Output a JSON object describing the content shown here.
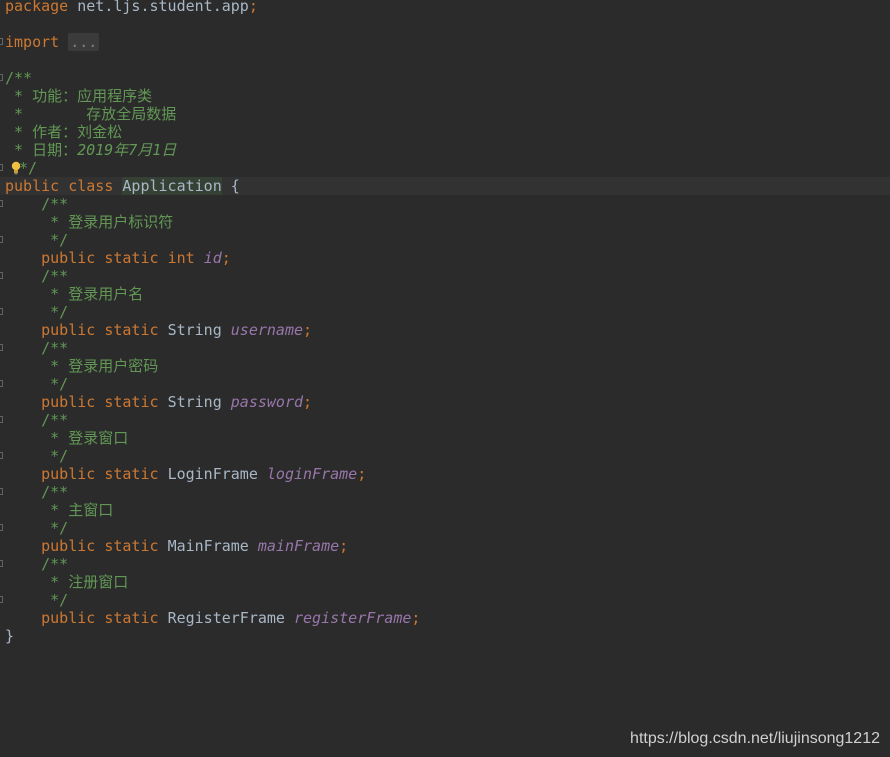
{
  "code": {
    "package_kw": "package",
    "package_name": "net.ljs.student.app",
    "semicolon": ";",
    "import_kw": "import",
    "import_folded": "...",
    "doc_open": "/**",
    "doc_close": "*/",
    "class_doc": {
      "line1": " * 功能：应用程序类",
      "line2": " *       存放全局数据",
      "line3": " * 作者：刘金松",
      "line4_prefix": " * 日期：",
      "line4_date": "2019年7月1日"
    },
    "class_decl": {
      "public_kw": "public",
      "class_kw": "class",
      "name": "Application",
      "open_brace": " {"
    },
    "fields": [
      {
        "doc": " * 登录用户标识符",
        "static_kw": "static",
        "type": "int",
        "type_is_keyword": true,
        "name": "id"
      },
      {
        "doc": " * 登录用户名",
        "static_kw": "static",
        "type": "String",
        "name": "username"
      },
      {
        "doc": " * 登录用户密码",
        "static_kw": "static",
        "type": "String",
        "name": "password"
      },
      {
        "doc": " * 登录窗口",
        "static_kw": "static",
        "type": "LoginFrame",
        "name": "loginFrame"
      },
      {
        "doc": " * 主窗口",
        "static_kw": "static",
        "type": "MainFrame",
        "name": "mainFrame"
      },
      {
        "doc": " * 注册窗口",
        "static_kw": "static",
        "type": "RegisterFrame",
        "name": "registerFrame"
      }
    ],
    "close_brace": "}"
  },
  "watermark": "https://blog.csdn.net/liujinsong1212",
  "icons": {
    "intention": "lightbulb-icon",
    "fold": "fold-marker-icon"
  },
  "colors": {
    "background": "#2b2b2b",
    "keyword": "#cc7832",
    "doc_comment": "#629755",
    "field": "#9876aa",
    "text": "#a9b7c6"
  }
}
